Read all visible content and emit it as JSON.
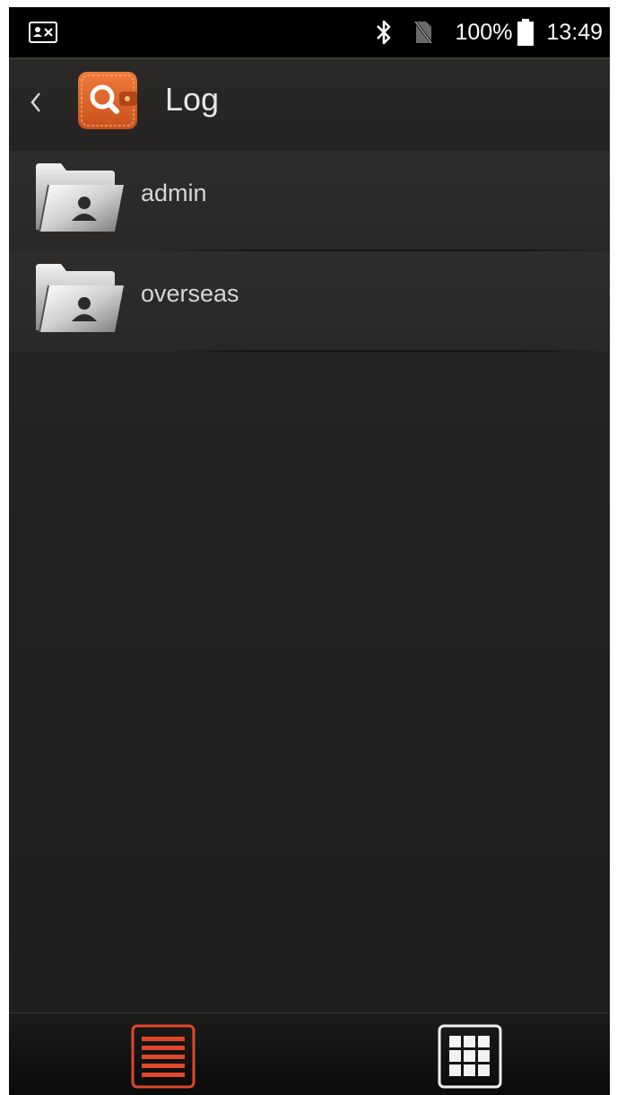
{
  "status_bar": {
    "notification_icon": "contact-card-x-icon",
    "bluetooth_icon": "bluetooth-icon",
    "sim_icon": "no-sim-icon",
    "battery_percent": "100%",
    "battery_icon": "battery-full-icon",
    "time": "13:49"
  },
  "header": {
    "back_icon": "chevron-left-icon",
    "app_icon": "wallet-search-icon",
    "title": "Log",
    "accent_color": "#e0672a"
  },
  "folders": [
    {
      "label": "admin",
      "icon": "user-folder-icon"
    },
    {
      "label": "overseas",
      "icon": "user-folder-icon"
    }
  ],
  "bottom_bar": {
    "list_view_icon": "list-view-icon",
    "grid_view_icon": "grid-view-icon",
    "active_view": "list",
    "active_color": "#e0472a"
  }
}
